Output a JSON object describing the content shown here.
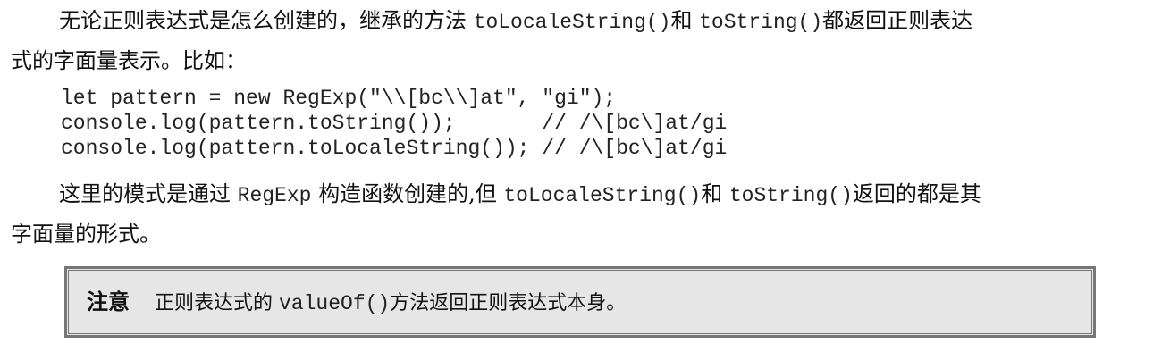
{
  "paragraph1": {
    "line1_a": "无论正则表达式是怎么创建的，继承的方法 ",
    "code1": "toLocaleString()",
    "line1_b": "和 ",
    "code2": "toString()",
    "line1_c": "都返回正则表达",
    "line2": "式的字面量表示。比如："
  },
  "code_lines": [
    "let pattern = new RegExp(\"\\\\[bc\\\\]at\", \"gi\");",
    "console.log(pattern.toString());       // /\\[bc\\]at/gi",
    "console.log(pattern.toLocaleString()); // /\\[bc\\]at/gi"
  ],
  "paragraph2": {
    "line1_a": "这里的模式是通过 ",
    "code1": "RegExp",
    "line1_b": " 构造函数创建的,但 ",
    "code2": "toLocaleString()",
    "line1_c": "和 ",
    "code3": "toString()",
    "line1_d": "返回的都是其",
    "line2": "字面量的形式。"
  },
  "note": {
    "label": "注意",
    "text_a": "正则表达式的 ",
    "code": "valueOf()",
    "text_b": "方法返回正则表达式本身。"
  }
}
